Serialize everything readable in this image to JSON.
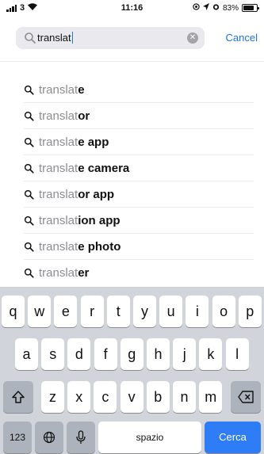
{
  "status_bar": {
    "carrier": "3",
    "time": "11:16",
    "battery": "83%",
    "battery_level": 0.83
  },
  "search": {
    "query": "translat",
    "cancel_label": "Cancel",
    "icon": "search-icon"
  },
  "suggestions": [
    {
      "typed": "translat",
      "rest": "e"
    },
    {
      "typed": "translat",
      "rest": "or"
    },
    {
      "typed": "translat",
      "rest": "e app"
    },
    {
      "typed": "translat",
      "rest": "e camera"
    },
    {
      "typed": "translat",
      "rest": "or app"
    },
    {
      "typed": "translat",
      "rest": "ion app"
    },
    {
      "typed": "translat",
      "rest": "e photo"
    },
    {
      "typed": "translat",
      "rest": "er"
    }
  ],
  "keyboard": {
    "row1": [
      "q",
      "w",
      "e",
      "r",
      "t",
      "y",
      "u",
      "i",
      "o",
      "p"
    ],
    "row2": [
      "a",
      "s",
      "d",
      "f",
      "g",
      "h",
      "j",
      "k",
      "l"
    ],
    "row3": [
      "z",
      "x",
      "c",
      "v",
      "b",
      "n",
      "m"
    ],
    "numbers_label": "123",
    "space_label": "spazio",
    "return_label": "Cerca",
    "accent_color": "#2f7df6"
  }
}
